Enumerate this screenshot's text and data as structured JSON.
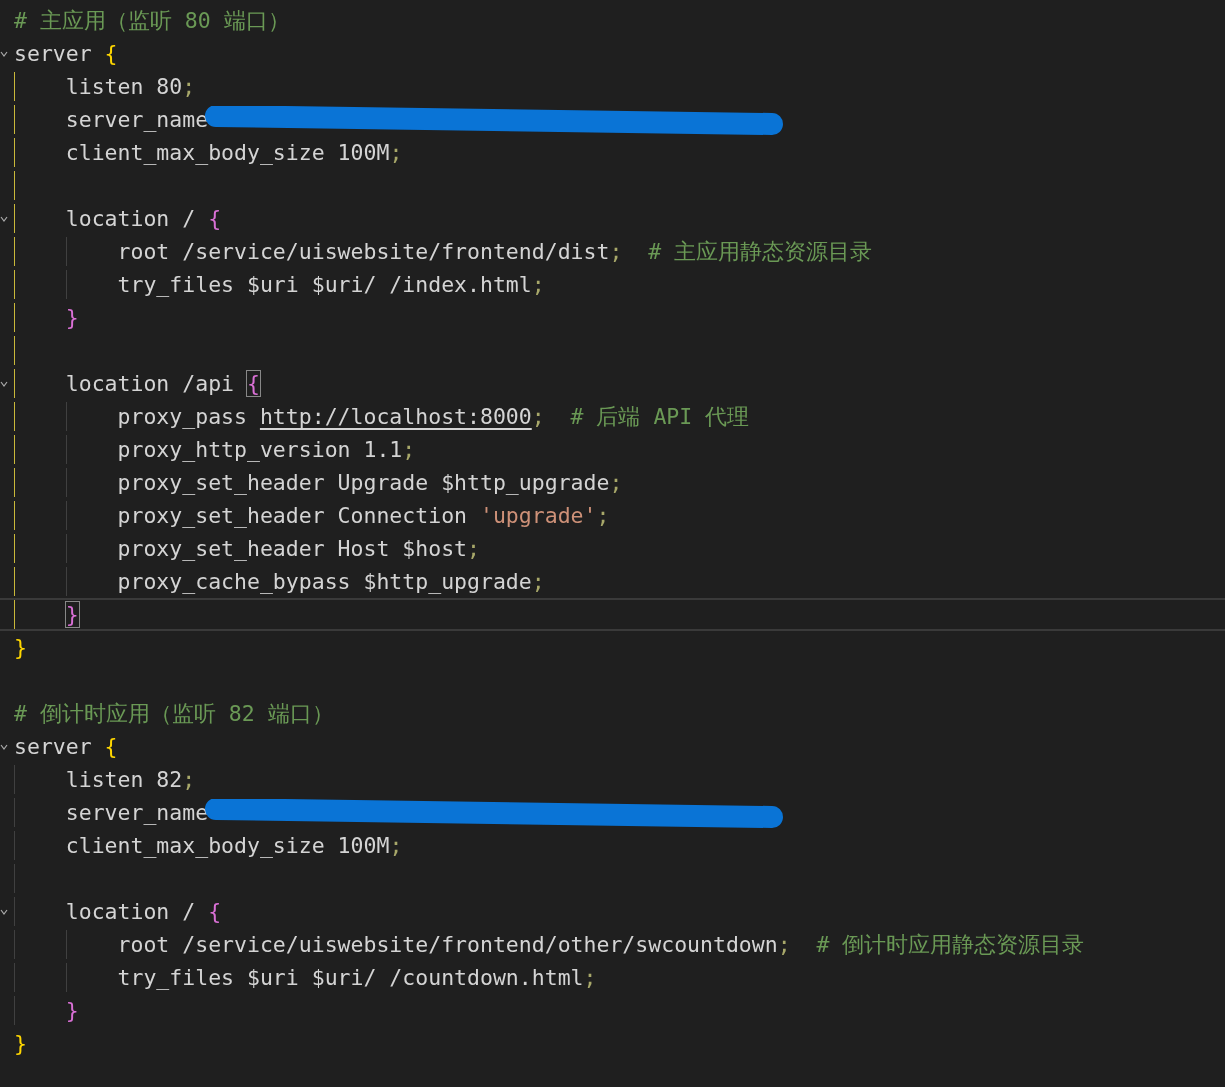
{
  "editor": {
    "lines": [
      {
        "kind": "comment",
        "text": "# 主应用（监听 80 端口）"
      },
      {
        "kind": "block",
        "expanded": true,
        "active": true,
        "open": [
          {
            "kind": "text",
            "text": "server"
          },
          {
            "kind": "brace",
            "text": "{",
            "color": "#ffd700"
          }
        ],
        "close": {
          "text": "}",
          "color": "#ffd700"
        },
        "bracket_matched": false,
        "cursor_on_close": false,
        "children": [
          {
            "kind": "line",
            "tokens": [
              {
                "kind": "text",
                "text": "listen 80"
              },
              {
                "kind": "punct",
                "text": ";"
              }
            ]
          },
          {
            "kind": "line",
            "tokens": [
              {
                "kind": "text",
                "text": "server_name"
              },
              {
                "kind": "redaction"
              }
            ]
          },
          {
            "kind": "line",
            "tokens": [
              {
                "kind": "text",
                "text": "client_max_body_size 100M"
              },
              {
                "kind": "punct",
                "text": ";"
              }
            ]
          },
          {
            "kind": "blank"
          },
          {
            "kind": "block",
            "expanded": true,
            "active": false,
            "open": [
              {
                "kind": "text",
                "text": "location /"
              },
              {
                "kind": "brace",
                "text": "{",
                "color": "#da70d6"
              }
            ],
            "close": {
              "text": "}",
              "color": "#da70d6"
            },
            "bracket_matched": false,
            "cursor_on_close": false,
            "children": [
              {
                "kind": "line",
                "tokens": [
                  {
                    "kind": "text",
                    "text": "root /service/uiswebsite/frontend/dist"
                  },
                  {
                    "kind": "punct",
                    "text": ";"
                  },
                  {
                    "kind": "comment",
                    "text": "# 主应用静态资源目录"
                  }
                ]
              },
              {
                "kind": "line",
                "tokens": [
                  {
                    "kind": "text",
                    "text": "try_files $uri $uri/ /index.html"
                  },
                  {
                    "kind": "punct",
                    "text": ";"
                  }
                ]
              }
            ]
          },
          {
            "kind": "blank"
          },
          {
            "kind": "block",
            "expanded": true,
            "active": false,
            "open": [
              {
                "kind": "text",
                "text": "location /api"
              },
              {
                "kind": "brace",
                "text": "{",
                "color": "#da70d6"
              }
            ],
            "close": {
              "text": "}",
              "color": "#da70d6"
            },
            "bracket_matched": true,
            "cursor_on_close": true,
            "children": [
              {
                "kind": "line",
                "tokens": [
                  {
                    "kind": "text",
                    "text": "proxy_pass"
                  },
                  {
                    "kind": "link",
                    "text": "http://localhost:8000"
                  },
                  {
                    "kind": "punct",
                    "text": ";"
                  },
                  {
                    "kind": "comment",
                    "text": "# 后端 API 代理"
                  }
                ]
              },
              {
                "kind": "line",
                "tokens": [
                  {
                    "kind": "text",
                    "text": "proxy_http_version 1.1"
                  },
                  {
                    "kind": "punct",
                    "text": ";"
                  }
                ]
              },
              {
                "kind": "line",
                "tokens": [
                  {
                    "kind": "text",
                    "text": "proxy_set_header Upgrade $http_upgrade"
                  },
                  {
                    "kind": "punct",
                    "text": ";"
                  }
                ]
              },
              {
                "kind": "line",
                "tokens": [
                  {
                    "kind": "text",
                    "text": "proxy_set_header Connection"
                  },
                  {
                    "kind": "string",
                    "text": "'upgrade'"
                  },
                  {
                    "kind": "punct",
                    "text": ";"
                  }
                ]
              },
              {
                "kind": "line",
                "tokens": [
                  {
                    "kind": "text",
                    "text": "proxy_set_header Host $host"
                  },
                  {
                    "kind": "punct",
                    "text": ";"
                  }
                ]
              },
              {
                "kind": "line",
                "tokens": [
                  {
                    "kind": "text",
                    "text": "proxy_cache_bypass $http_upgrade"
                  },
                  {
                    "kind": "punct",
                    "text": ";"
                  }
                ]
              }
            ]
          }
        ]
      },
      {
        "kind": "blank"
      },
      {
        "kind": "comment",
        "text": "# 倒计时应用（监听 82 端口）"
      },
      {
        "kind": "block",
        "expanded": true,
        "active": false,
        "open": [
          {
            "kind": "text",
            "text": "server"
          },
          {
            "kind": "brace",
            "text": "{",
            "color": "#ffd700"
          }
        ],
        "close": {
          "text": "}",
          "color": "#ffd700"
        },
        "bracket_matched": false,
        "cursor_on_close": false,
        "children": [
          {
            "kind": "line",
            "tokens": [
              {
                "kind": "text",
                "text": "listen 82"
              },
              {
                "kind": "punct",
                "text": ";"
              }
            ]
          },
          {
            "kind": "line",
            "tokens": [
              {
                "kind": "text",
                "text": "server_name"
              },
              {
                "kind": "redaction"
              }
            ]
          },
          {
            "kind": "line",
            "tokens": [
              {
                "kind": "text",
                "text": "client_max_body_size 100M"
              },
              {
                "kind": "punct",
                "text": ";"
              }
            ]
          },
          {
            "kind": "blank"
          },
          {
            "kind": "block",
            "expanded": true,
            "active": false,
            "open": [
              {
                "kind": "text",
                "text": "location /"
              },
              {
                "kind": "brace",
                "text": "{",
                "color": "#da70d6"
              }
            ],
            "close": {
              "text": "}",
              "color": "#da70d6"
            },
            "bracket_matched": false,
            "cursor_on_close": false,
            "children": [
              {
                "kind": "line",
                "tokens": [
                  {
                    "kind": "text",
                    "text": "root /service/uiswebsite/frontend/other/swcountdown"
                  },
                  {
                    "kind": "punct",
                    "text": ";"
                  },
                  {
                    "kind": "comment",
                    "text": "# 倒计时应用静态资源目录"
                  }
                ]
              },
              {
                "kind": "line",
                "tokens": [
                  {
                    "kind": "text",
                    "text": "try_files $uri $uri/ /countdown.html"
                  },
                  {
                    "kind": "punct",
                    "text": ";"
                  }
                ]
              }
            ]
          }
        ]
      }
    ]
  }
}
